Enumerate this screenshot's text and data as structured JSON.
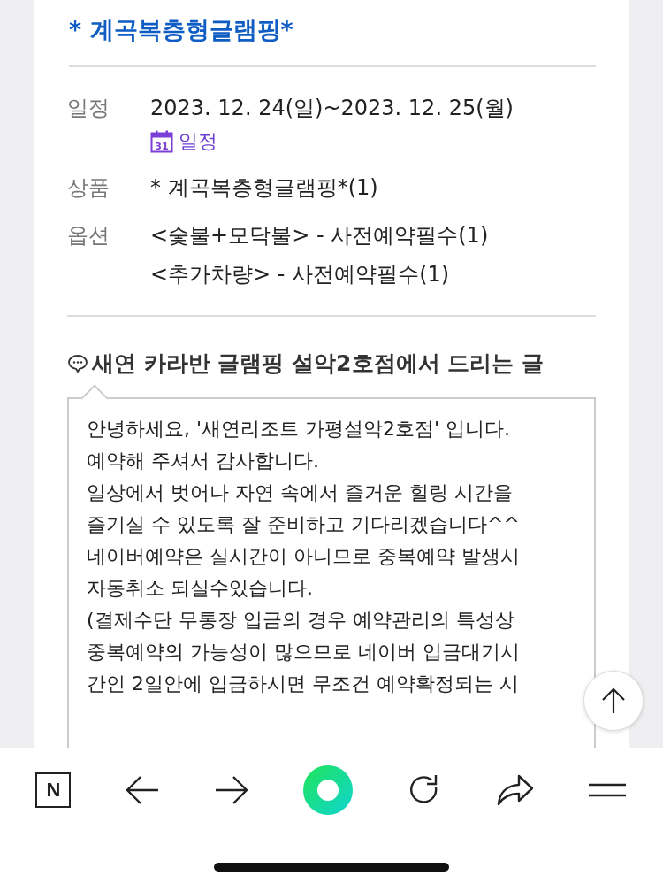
{
  "title": "* 계곡복층형글램핑*",
  "details": [
    {
      "label": "일정",
      "values": [
        "2023. 12. 24(일)~2023. 12. 25(월)"
      ],
      "link": "일정"
    },
    {
      "label": "상품",
      "values": [
        "* 계곡복층형글램핑*(1)"
      ]
    },
    {
      "label": "옵션",
      "values": [
        "<숯불+모닥불> - 사전예약필수(1)",
        "<추가차량> - 사전예약필수(1)"
      ]
    }
  ],
  "message": {
    "heading": "새연 카라반 글램핑 설악2호점에서 드리는 글",
    "lines": [
      "안녕하세요, '새연리조트 가평설악2호점' 입니다.",
      "예약해 주셔서 감사합니다.",
      "일상에서 벗어나 자연 속에서 즐거운 힐링 시간을",
      "즐기실 수 있도록 잘 준비하고 기다리겠습니다^^",
      "네이버예약은 실시간이 아니므로 중복예약 발생시",
      "자동취소 되실수있습니다.",
      "(결제수단 무통장 입금의 경우 예약관리의 특성상",
      "중복예약의 가능성이 많으므로 네이버 입금대기시",
      "간인 2일안에 입금하시면 무조건 예약확정되는 시"
    ]
  },
  "calendar_icon_text": "31",
  "logo_letter": "N"
}
